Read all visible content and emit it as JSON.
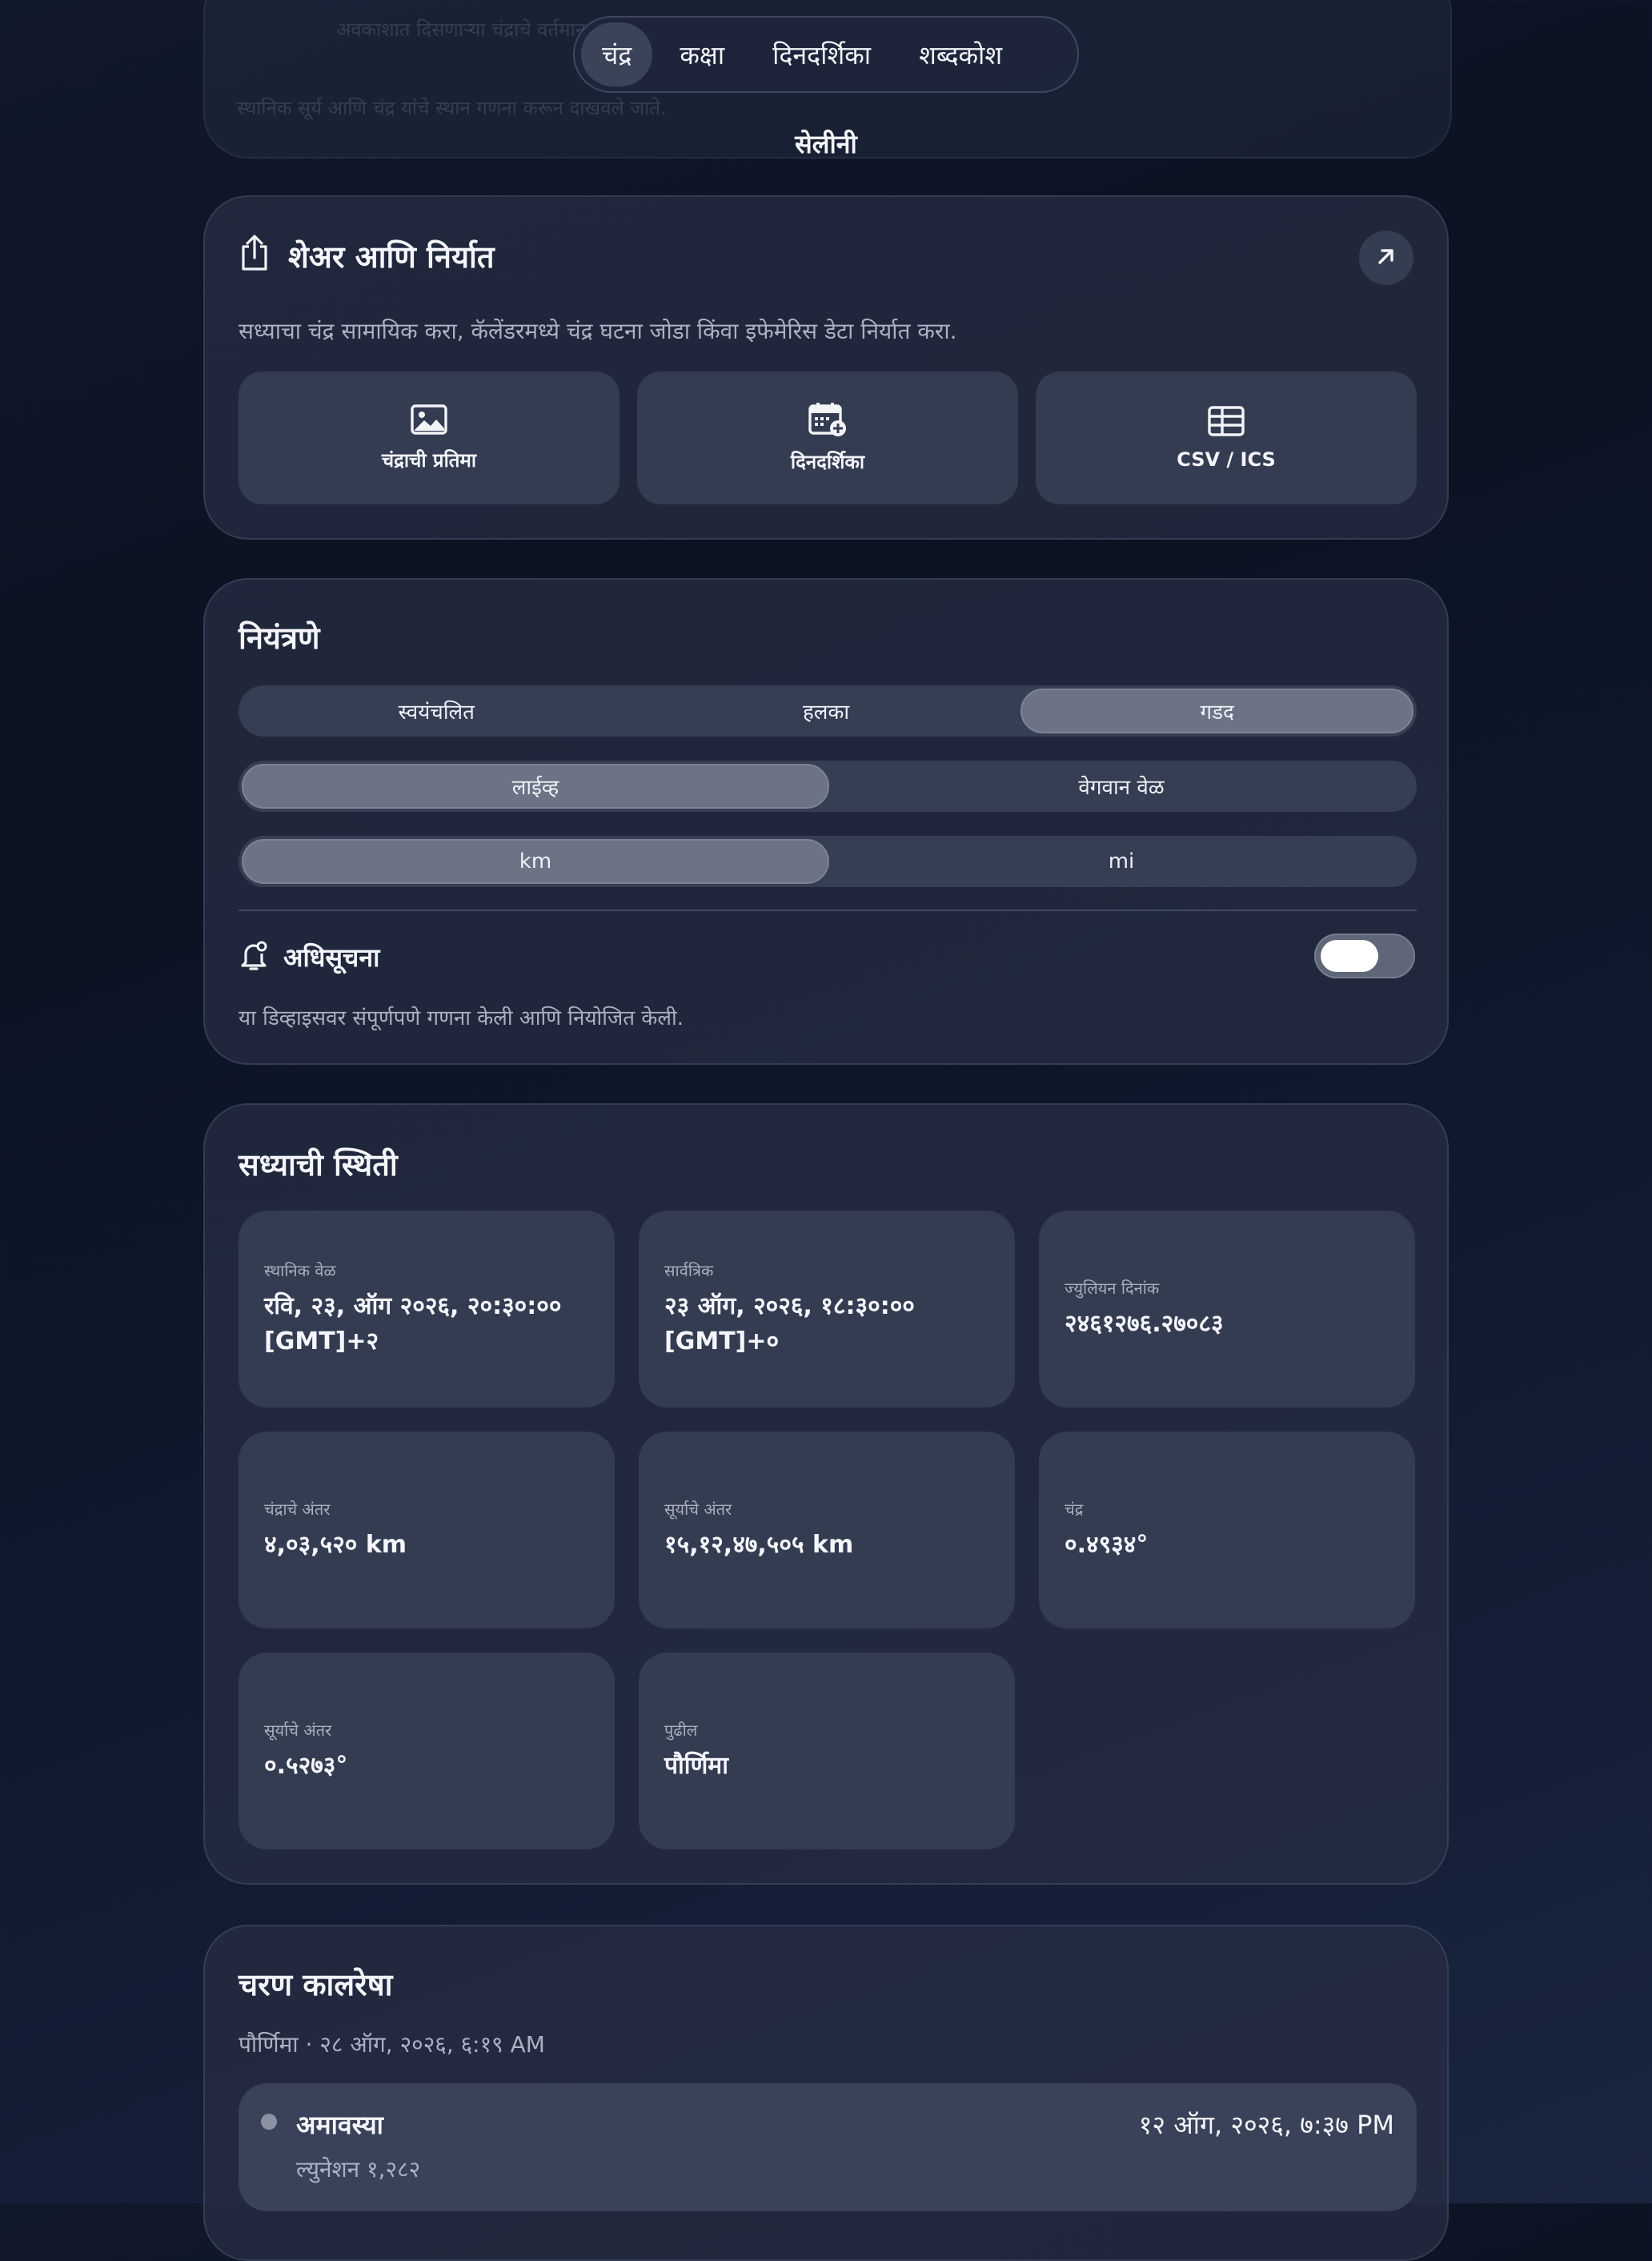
{
  "background_text": {
    "line1": "अवकाशात दिसणाऱ्या चंद्राचे वर्तमान दृश्य",
    "line2": "स्थानिक सूर्य आणि चंद्र यांचे स्थान गणना करून दाखवले जाते."
  },
  "nav": {
    "tabs": [
      {
        "label": "चंद्र",
        "active": true
      },
      {
        "label": "कक्षा",
        "active": false
      },
      {
        "label": "दिनदर्शिका",
        "active": false
      },
      {
        "label": "शब्दकोश",
        "active": false
      }
    ]
  },
  "app_title": "सेलीनी",
  "share": {
    "title": "शेअर आणि निर्यात",
    "description": "सध्याचा चंद्र सामायिक करा, कॅलेंडरमध्ये चंद्र घटना जोडा किंवा इफेमेरिस डेटा निर्यात करा.",
    "tiles": [
      {
        "label": "चंद्राची प्रतिमा",
        "icon": "image-icon"
      },
      {
        "label": "दिनदर्शिका",
        "icon": "calendar-add-icon"
      },
      {
        "label": "CSV / ICS",
        "icon": "table-icon"
      }
    ],
    "open_icon": "arrow-up-right-icon"
  },
  "controls": {
    "title": "नियंत्रणे",
    "theme": [
      "स्वयंचलित",
      "हलका",
      "गडद"
    ],
    "theme_selected": 2,
    "time_mode": [
      "लाईव्ह",
      "वेगवान वेळ"
    ],
    "time_selected": 0,
    "units": [
      "km",
      "mi"
    ],
    "units_selected": 0,
    "notifications_label": "अधिसूचना",
    "notifications_on": false,
    "note": "या डिव्हाइसवर संपूर्णपणे गणना केली आणि नियोजित केली."
  },
  "status": {
    "title": "सध्याची स्थिती",
    "items": [
      {
        "label": "स्थानिक वेळ",
        "value": "रवि, २३, ऑग २०२६, २०:३०:०० [GMT]+२"
      },
      {
        "label": "सार्वत्रिक",
        "value": "२३ ऑग, २०२६, १८:३०:०० [GMT]+०"
      },
      {
        "label": "ज्युलियन दिनांक",
        "value": "२४६१२७६.२७०८३"
      },
      {
        "label": "चंद्राचे अंतर",
        "value": "४,०३,५२० km"
      },
      {
        "label": "सूर्याचे अंतर",
        "value": "१५,१२,४७,५०५ km"
      },
      {
        "label": "चंद्र",
        "value": "०.४९३४°"
      },
      {
        "label": "सूर्याचे अंतर",
        "value": "०.५२७३°"
      },
      {
        "label": "पुढील",
        "value": "पौर्णिमा"
      }
    ]
  },
  "timeline": {
    "title": "चरण कालरेषा",
    "subtitle": "पौर्णिमा · २८ ऑग, २०२६, ६:१९ AM",
    "rows": [
      {
        "phase": "अमावस्या",
        "date": "१२ ऑग, २०२६, ७:३७ PM",
        "lunation": "ल्युनेशन १,२८२"
      }
    ]
  },
  "colors": {
    "background": "#0b1322",
    "card": "#262d42",
    "tile": "#343c52",
    "active_segment": "#6b7385",
    "text": "#f2f4f8",
    "muted": "#a9b1c3"
  }
}
